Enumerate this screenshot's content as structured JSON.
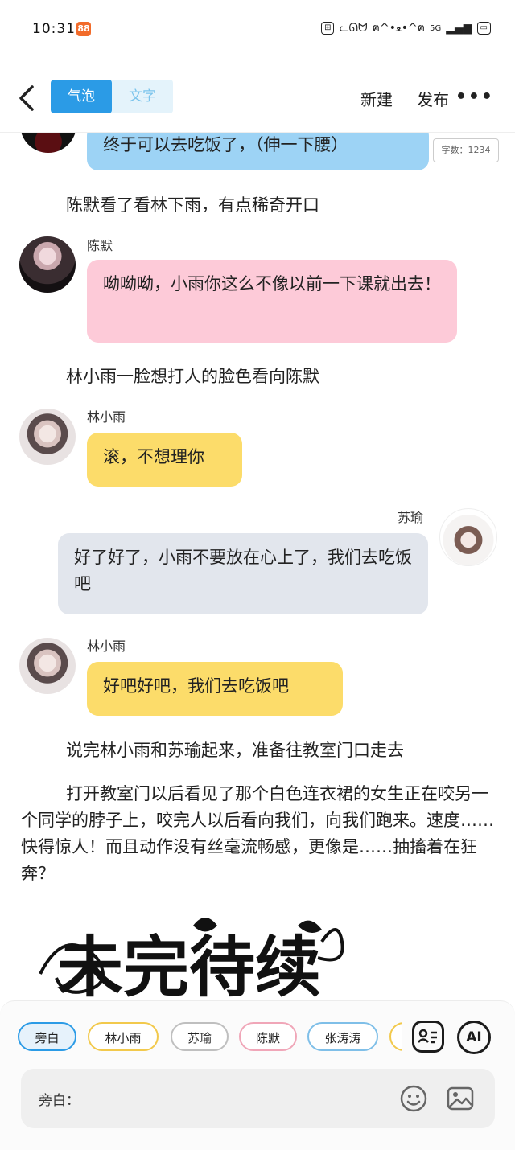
{
  "status_bar": {
    "time": "10:31",
    "notification_badge": "88",
    "network_label": "5G"
  },
  "nav": {
    "tab_bubble": "气泡",
    "tab_text": "文字",
    "new_label": "新建",
    "publish_label": "发布",
    "more_label": "•••"
  },
  "chat": {
    "word_count": "字数：1234",
    "messages": [
      {
        "type": "bubble",
        "side": "left",
        "speaker": "",
        "text": "终于可以去吃饭了，（伸一下腰）",
        "color": "#9dd3f5"
      },
      {
        "type": "narration",
        "text": "陈默看了看林下雨，有点稀奇开口"
      },
      {
        "type": "bubble",
        "side": "left",
        "speaker": "陈默",
        "text": "呦呦呦，小雨你这么不像以前一下课就出去！",
        "color": "#fdcad8"
      },
      {
        "type": "narration",
        "text": "林小雨一脸想打人的脸色看向陈默"
      },
      {
        "type": "bubble",
        "side": "left",
        "speaker": "林小雨",
        "text": "滚，不想理你",
        "color": "#fcdc6a"
      },
      {
        "type": "bubble",
        "side": "right",
        "speaker": "苏瑜",
        "text": "好了好了，小雨不要放在心上了，我们去吃饭吧",
        "color": "#e2e6ed"
      },
      {
        "type": "bubble",
        "side": "left",
        "speaker": "林小雨",
        "text": "好吧好吧，我们去吃饭吧",
        "color": "#fcdc6a"
      },
      {
        "type": "narration",
        "text": "说完林小雨和苏瑜起来，准备往教室门口走去"
      },
      {
        "type": "narration",
        "text": "打开教室门以后看见了那个白色连衣裙的女生正在咬另一个同学的脖子上，咬完人以后看向我们，向我们跑来。速度……快得惊人！而且动作没有丝毫流畅感，更像是……抽搐着在狂奔？"
      }
    ],
    "banner_text": "未完待续"
  },
  "composer": {
    "roles": [
      {
        "label": "旁白",
        "color": "#2b9be6",
        "selected": true
      },
      {
        "label": "林小雨",
        "color": "#f2c94c",
        "selected": false
      },
      {
        "label": "苏瑜",
        "color": "#bfbfbf",
        "selected": false
      },
      {
        "label": "陈默",
        "color": "#f0a6b8",
        "selected": false
      },
      {
        "label": "张涛涛",
        "color": "#7fbfe8",
        "selected": false
      }
    ],
    "ai_label": "AI",
    "input_label": "旁白："
  }
}
